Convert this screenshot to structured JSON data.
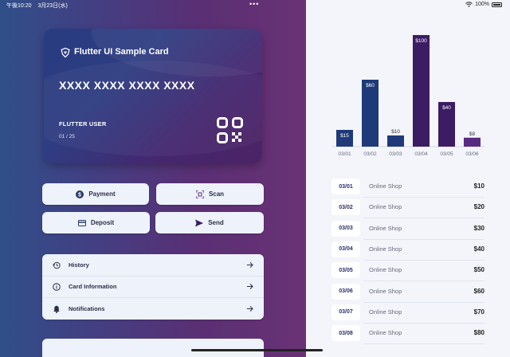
{
  "status_bar": {
    "time": "午後10:20",
    "date": "3月23日(水)",
    "battery": "100%"
  },
  "card": {
    "title": "Flutter UI Sample Card",
    "number": "XXXX XXXX XXXX XXXX",
    "holder": "FLUTTER USER",
    "expiry": "01 / 25"
  },
  "actions": {
    "payment": "Payment",
    "scan": "Scan",
    "deposit": "Deposit",
    "send": "Send"
  },
  "menu": [
    {
      "label": "History",
      "icon": "history-icon"
    },
    {
      "label": "Card Information",
      "icon": "info-icon"
    },
    {
      "label": "Notifications",
      "icon": "bell-icon"
    }
  ],
  "colors": {
    "bar_dark_blue": "#1e3a78",
    "bar_purple": "#3c1c63",
    "bar_purple_light": "#5a2a80",
    "card_bg": "#2f3d82"
  },
  "chart_data": {
    "type": "bar",
    "categories": [
      "03/01",
      "03/02",
      "03/03",
      "03/04",
      "03/05",
      "03/06"
    ],
    "values": [
      15,
      60,
      10,
      100,
      40,
      8
    ],
    "labels": [
      "$15",
      "$60",
      "$10",
      "$100",
      "$40",
      "$8"
    ],
    "ylim": [
      0,
      100
    ],
    "title": "",
    "xlabel": "",
    "ylabel": "",
    "grid": false
  },
  "transactions": [
    {
      "date": "03/01",
      "shop": "Online Shop",
      "amount": "$10"
    },
    {
      "date": "03/02",
      "shop": "Online Shop",
      "amount": "$20"
    },
    {
      "date": "03/03",
      "shop": "Online Shop",
      "amount": "$30"
    },
    {
      "date": "03/04",
      "shop": "Online Shop",
      "amount": "$40"
    },
    {
      "date": "03/05",
      "shop": "Online Shop",
      "amount": "$50"
    },
    {
      "date": "03/06",
      "shop": "Online Shop",
      "amount": "$60"
    },
    {
      "date": "03/07",
      "shop": "Online Shop",
      "amount": "$70"
    },
    {
      "date": "03/08",
      "shop": "Online Shop",
      "amount": "$80"
    }
  ]
}
